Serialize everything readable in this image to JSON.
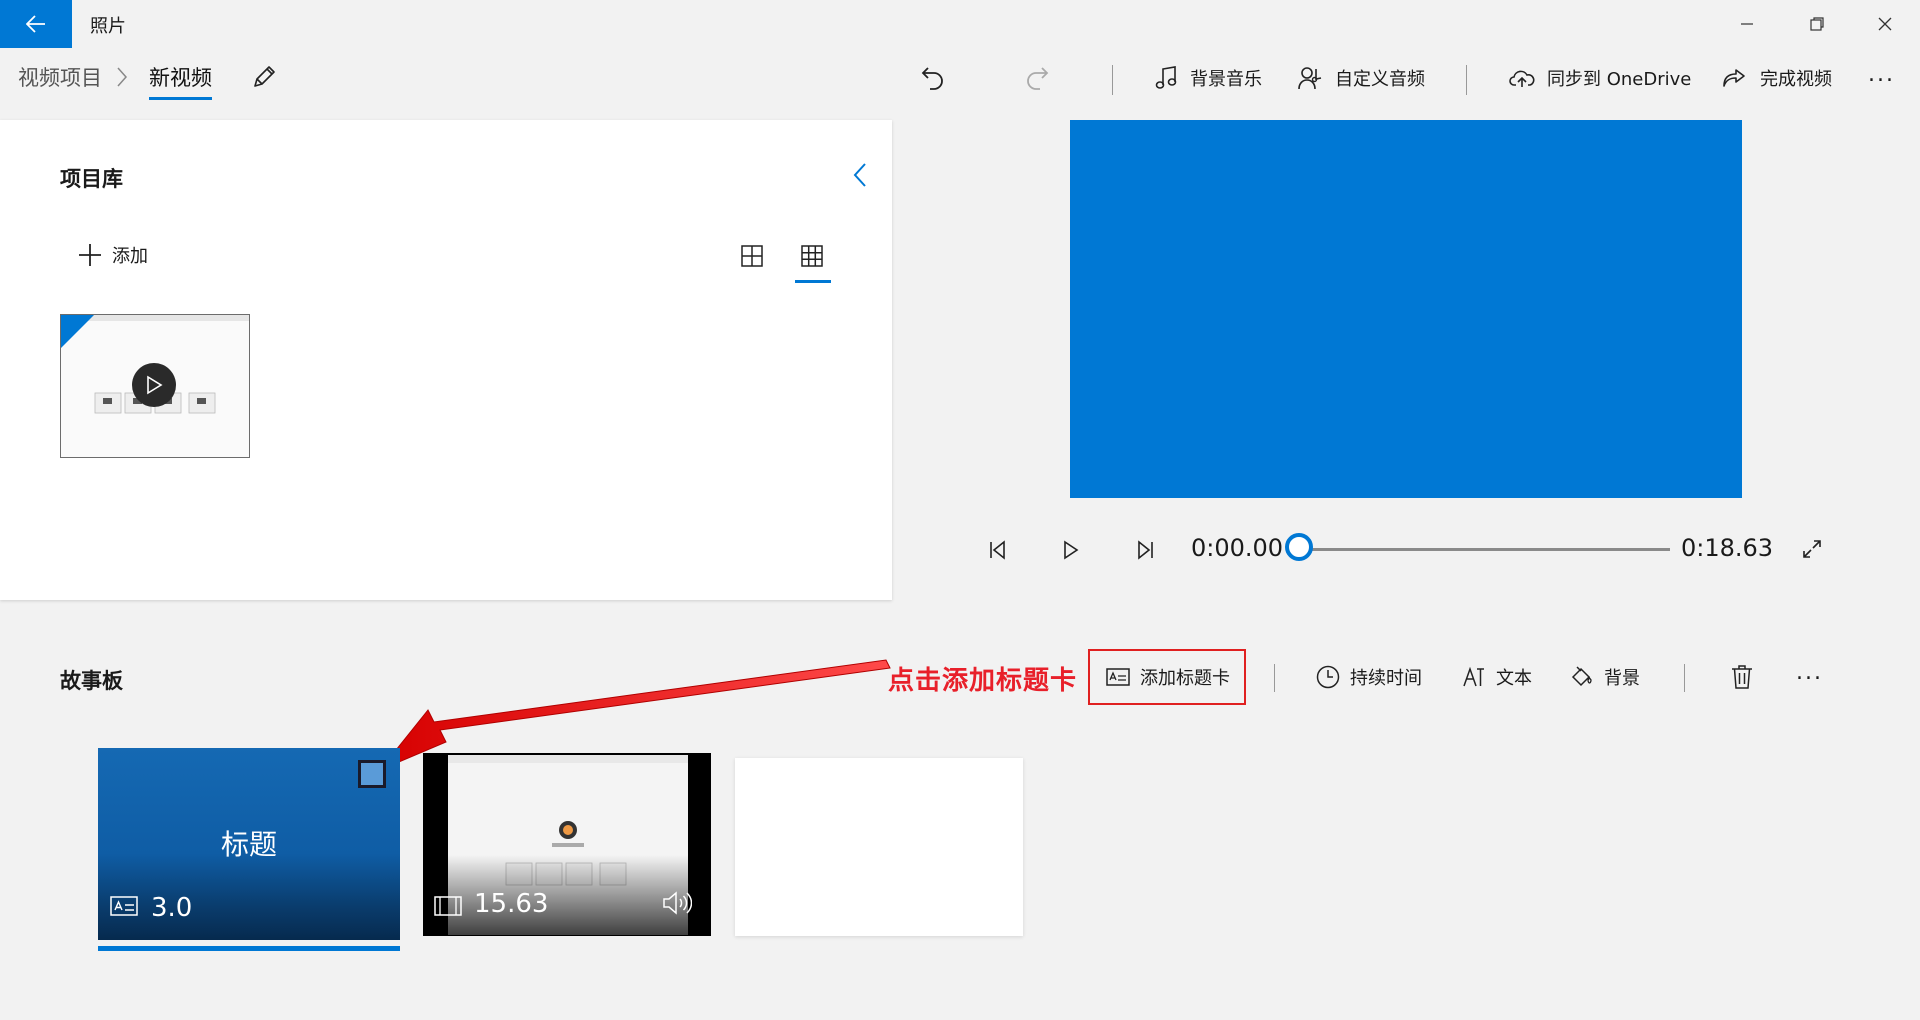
{
  "titlebar": {
    "app_title": "照片"
  },
  "breadcrumb": {
    "root": "视频项目",
    "current": "新视频"
  },
  "toolbar": {
    "music": "背景音乐",
    "custom_audio": "自定义音频",
    "onedrive": "同步到 OneDrive",
    "finish": "完成视频",
    "more": "..."
  },
  "library": {
    "title": "项目库",
    "add_label": "添加"
  },
  "player": {
    "current_time": "0:00.00",
    "end_time": "0:18.63",
    "progress": 0
  },
  "storyboard": {
    "title": "故事板",
    "add_title_card": "添加标题卡",
    "duration": "持续时间",
    "text": "文本",
    "background": "背景",
    "more": "..."
  },
  "annotation": {
    "text": "点击添加标题卡",
    "color": "#e8202a"
  },
  "timeline": {
    "cards": [
      {
        "label": "标题",
        "duration": "3.0"
      },
      {
        "duration": "15.63"
      }
    ]
  },
  "colors": {
    "accent": "#0078d4",
    "annotation": "#e8202a"
  }
}
